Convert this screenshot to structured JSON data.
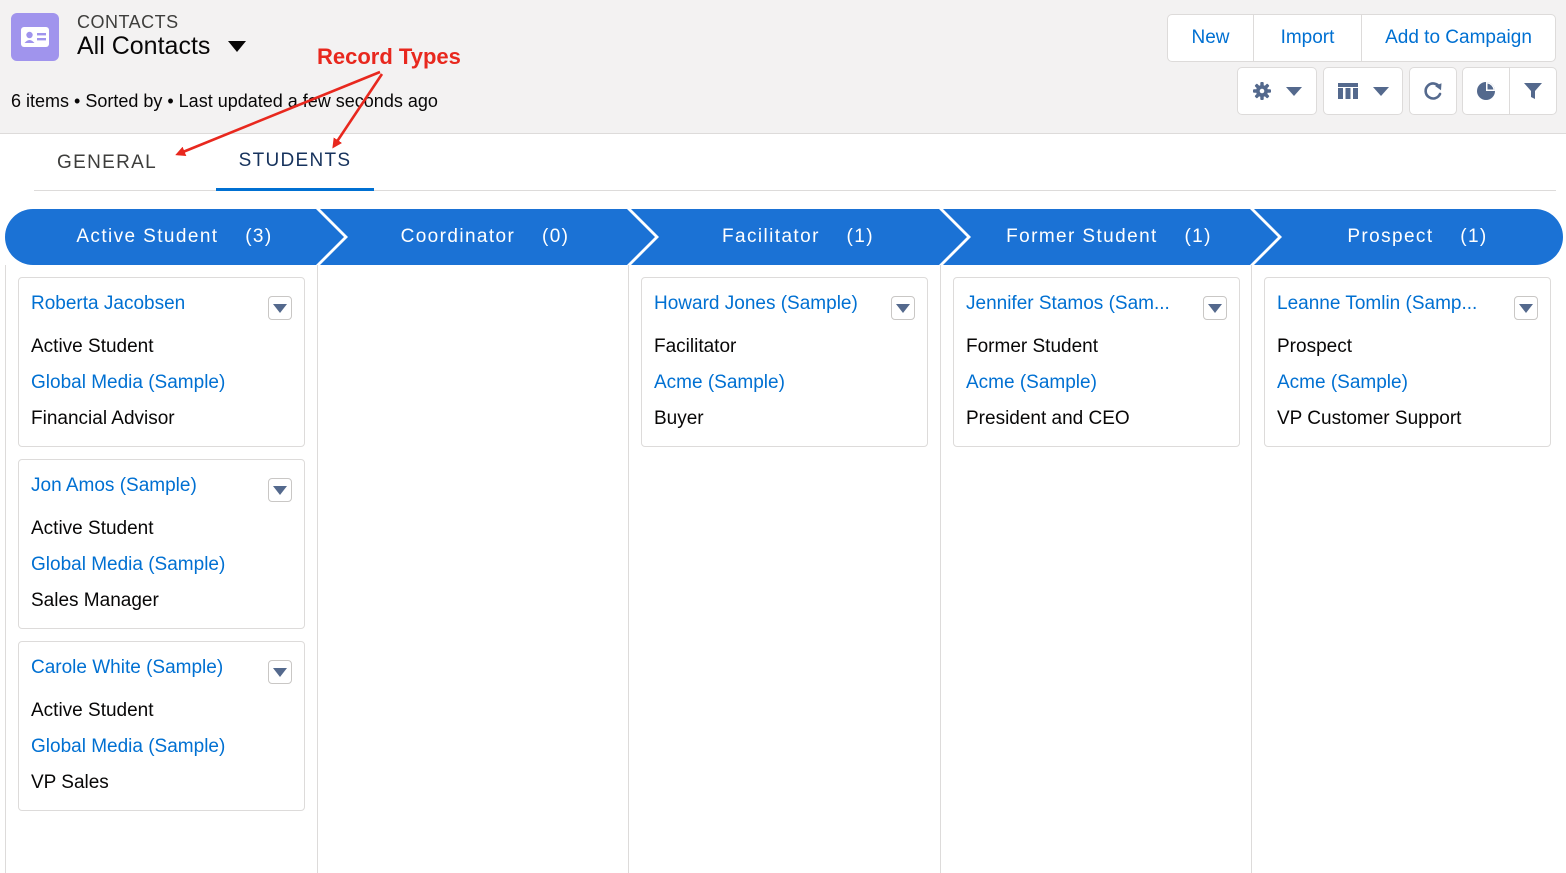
{
  "header": {
    "object_label": "CONTACTS",
    "list_view_name": "All Contacts",
    "meta": "6 items • Sorted by • Last updated a few seconds ago",
    "actions": {
      "new": "New",
      "import": "Import",
      "add_to_campaign": "Add to Campaign"
    },
    "tools": [
      "gear-icon",
      "table-icon",
      "refresh-icon",
      "chart-icon",
      "filter-icon"
    ]
  },
  "tabs": {
    "general": "GENERAL",
    "students": "STUDENTS",
    "selected": "STUDENTS"
  },
  "annotation": {
    "text": "Record Types",
    "color": "#e8281e"
  },
  "stages": [
    {
      "label": "Active Student    (3)"
    },
    {
      "label": "Coordinator    (0)"
    },
    {
      "label": "Facilitator    (1)"
    },
    {
      "label": "Former Student    (1)"
    },
    {
      "label": "Prospect    (1)"
    }
  ],
  "cards": {
    "c0": {
      "name": "Roberta Jacobsen",
      "type": "Active Student",
      "account": "Global Media (Sample)",
      "title": "Financial Advisor"
    },
    "c1": {
      "name": "Jon Amos (Sample)",
      "type": "Active Student",
      "account": "Global Media (Sample)",
      "title": "Sales Manager"
    },
    "c2": {
      "name": "Carole White (Sample)",
      "type": "Active Student",
      "account": "Global Media (Sample)",
      "title": "VP Sales"
    },
    "c3": {
      "name": "Howard Jones (Sample)",
      "type": "Facilitator",
      "account": "Acme (Sample)",
      "title": "Buyer"
    },
    "c4": {
      "name": "Jennifer Stamos (Sam...",
      "type": "Former Student",
      "account": "Acme (Sample)",
      "title": "President and CEO"
    },
    "c5": {
      "name": "Leanne Tomlin (Samp...",
      "type": "Prospect",
      "account": "Acme (Sample)",
      "title": "VP Customer Support"
    }
  },
  "colors": {
    "accent": "#0070d2",
    "stage": "#1b72d5",
    "object_icon": "#a094ed"
  }
}
